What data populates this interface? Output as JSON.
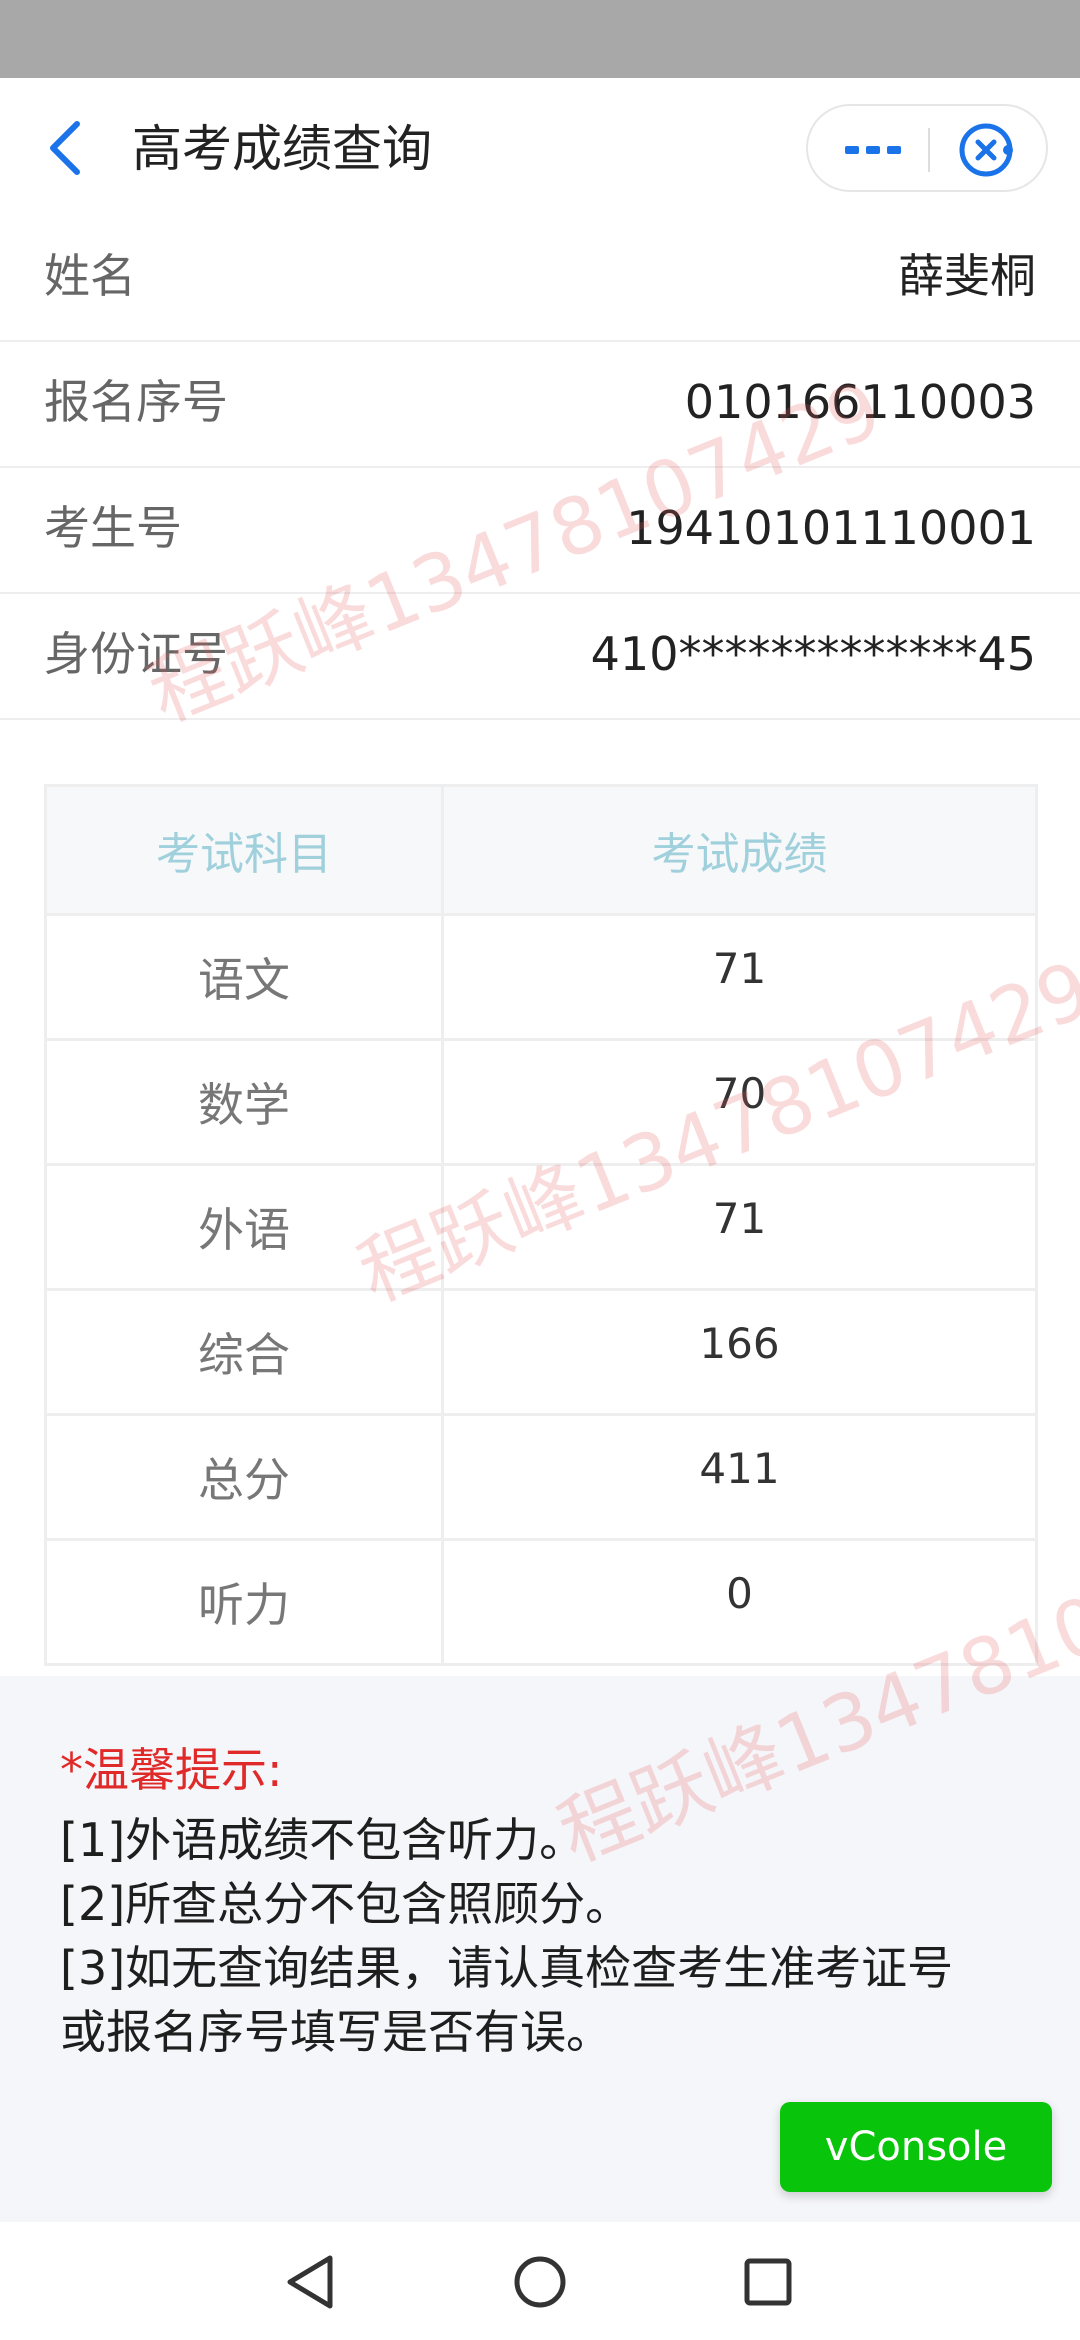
{
  "header": {
    "title": "高考成绩查询",
    "back_icon": "chevron-left-icon",
    "more_icon": "more-dots-icon",
    "close_icon": "close-circle-icon",
    "accent_color": "#1a73e8"
  },
  "info": [
    {
      "label": "姓名",
      "value": "薛斐桐"
    },
    {
      "label": "报名序号",
      "value": "010166110003"
    },
    {
      "label": "考生号",
      "value": "19410101110001"
    },
    {
      "label": "身份证号",
      "value": "410*************45"
    }
  ],
  "table": {
    "headers": [
      "考试科目",
      "考试成绩"
    ],
    "rows": [
      {
        "subject": "语文",
        "score": "71"
      },
      {
        "subject": "数学",
        "score": "70"
      },
      {
        "subject": "外语",
        "score": "71"
      },
      {
        "subject": "综合",
        "score": "166"
      },
      {
        "subject": "总分",
        "score": "411"
      },
      {
        "subject": "听力",
        "score": "0"
      }
    ]
  },
  "tips": {
    "title": "*温馨提示:",
    "lines": [
      "[1]外语成绩不包含听力。",
      "[2]所查总分不包含照顾分。",
      "[3]如无查询结果，请认真检查考生准考证号",
      "或报名序号填写是否有误。"
    ],
    "title_color": "#e02a2a"
  },
  "vconsole": {
    "label": "vConsole",
    "color": "#08c40a"
  },
  "watermark": {
    "text": "程跃峰13478107429"
  },
  "system_nav": {
    "back_icon": "triangle-back-icon",
    "home_icon": "circle-home-icon",
    "recents_icon": "square-recents-icon"
  }
}
